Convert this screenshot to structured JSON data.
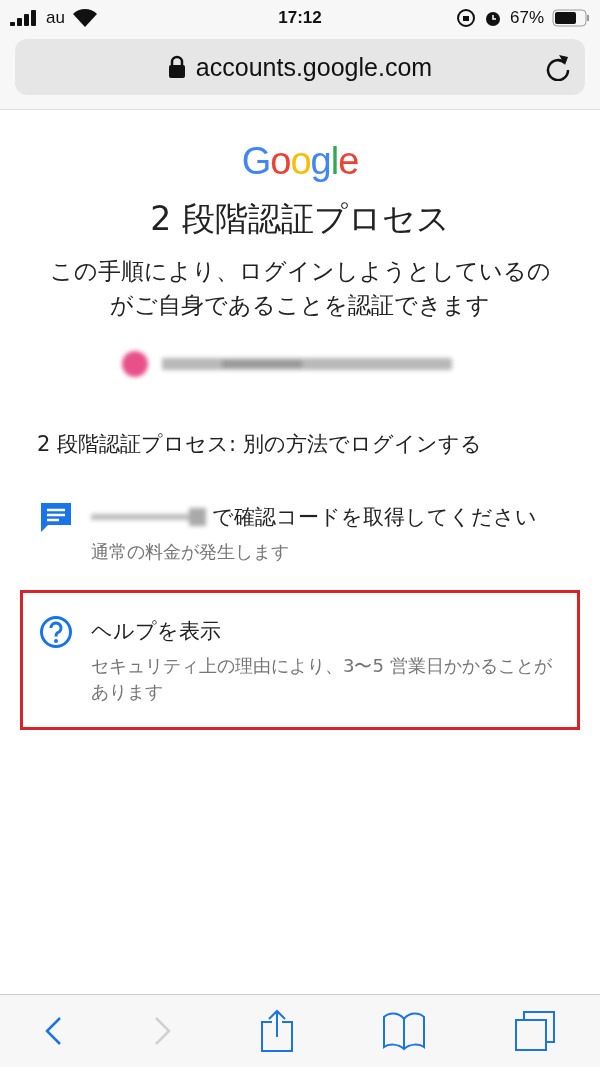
{
  "status_bar": {
    "carrier": "au",
    "time": "17:12",
    "battery": "67%"
  },
  "address_bar": {
    "url": "accounts.google.com"
  },
  "logo": "Google",
  "title": "2 段階認証プロセス",
  "subtitle": "この手順により、ログインしようとしているのがご自身であることを認証できます",
  "heading": "2 段階認証プロセス: 別の方法でログインする",
  "options": [
    {
      "kind": "sms",
      "title": "で確認コードを取得してください",
      "note": "通常の料金が発生します",
      "highlighted": false
    },
    {
      "kind": "help",
      "title": "ヘルプを表示",
      "note": "セキュリティ上の理由により、3〜5 営業日かかることがあります",
      "highlighted": true
    }
  ],
  "toolbar": [
    {
      "kind": "back",
      "disabled": false
    },
    {
      "kind": "forward",
      "disabled": true
    },
    {
      "kind": "share",
      "disabled": false
    },
    {
      "kind": "bookmarks",
      "disabled": false
    },
    {
      "kind": "tabs",
      "disabled": false
    }
  ]
}
